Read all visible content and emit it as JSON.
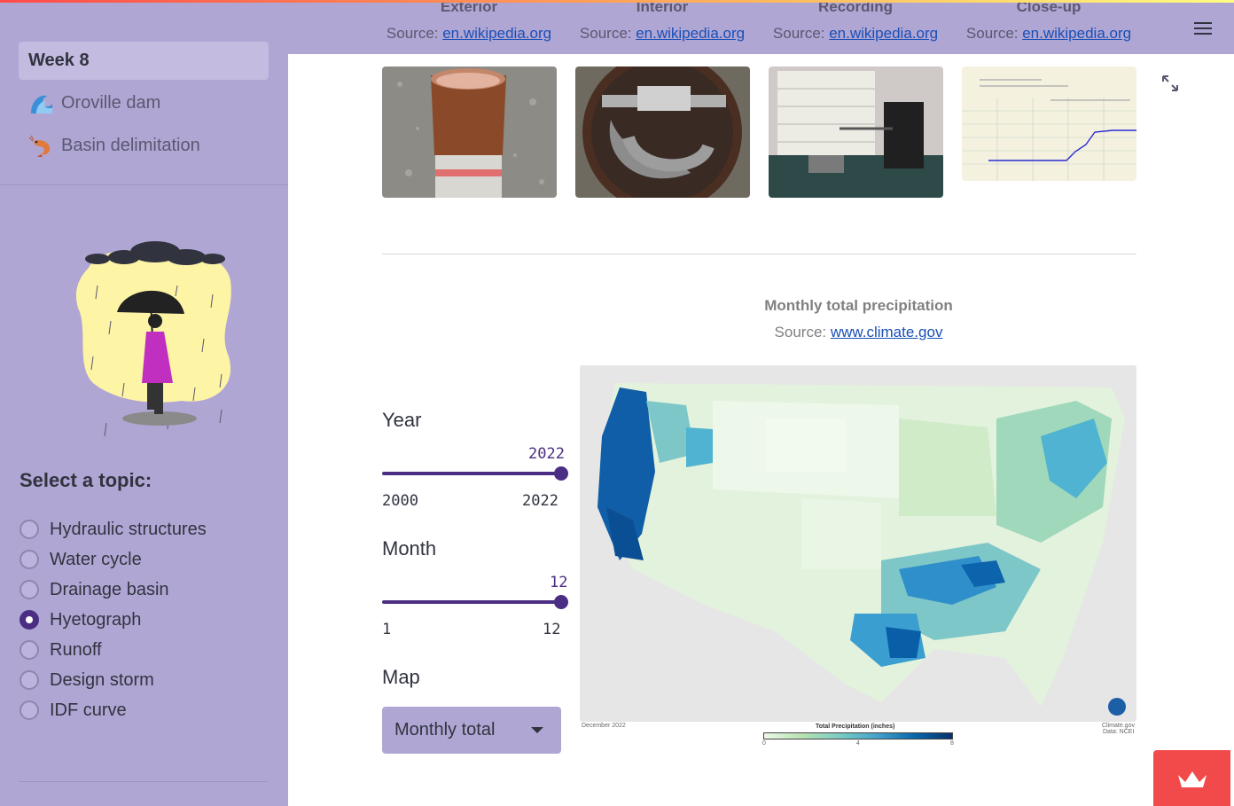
{
  "sidebar": {
    "nav": [
      {
        "label": "Week 8",
        "icon": ""
      },
      {
        "label": "Oroville dam",
        "icon": "wave-icon"
      },
      {
        "label": "Basin delimitation",
        "icon": "shrimp-icon"
      }
    ],
    "topic_title": "Select a topic:",
    "topics": [
      "Hydraulic structures",
      "Water cycle",
      "Drainage basin",
      "Hyetograph",
      "Runoff",
      "Design storm",
      "IDF curve"
    ],
    "selected_topic": "Hyetograph"
  },
  "gallery": {
    "items": [
      {
        "title": "Exterior",
        "source_prefix": "Source: ",
        "source_link": "en.wikipedia.org"
      },
      {
        "title": "Interior",
        "source_prefix": "Source: ",
        "source_link": "en.wikipedia.org"
      },
      {
        "title": "Recording",
        "source_prefix": "Source: ",
        "source_link": "en.wikipedia.org"
      },
      {
        "title": "Close-up",
        "source_prefix": "Source: ",
        "source_link": "en.wikipedia.org"
      }
    ]
  },
  "controls": {
    "year": {
      "label": "Year",
      "value": "2022",
      "min": "2000",
      "max": "2022"
    },
    "month": {
      "label": "Month",
      "value": "12",
      "min": "1",
      "max": "12"
    },
    "map": {
      "label": "Map",
      "selected": "Monthly total"
    }
  },
  "map_panel": {
    "title": "Monthly total precipitation",
    "source_prefix": "Source: ",
    "source_link": "www.climate.gov",
    "date_label": "December 2022",
    "legend_title": "Total Precipitation (inches)",
    "legend_ticks": [
      "0",
      "4",
      "8"
    ],
    "credit_1": "Climate.gov",
    "credit_2": "Data: NCEI"
  },
  "colors": {
    "accent": "#4b2e83",
    "sidebar_bg": "#b0a6d4",
    "link": "#1a4fb5"
  }
}
